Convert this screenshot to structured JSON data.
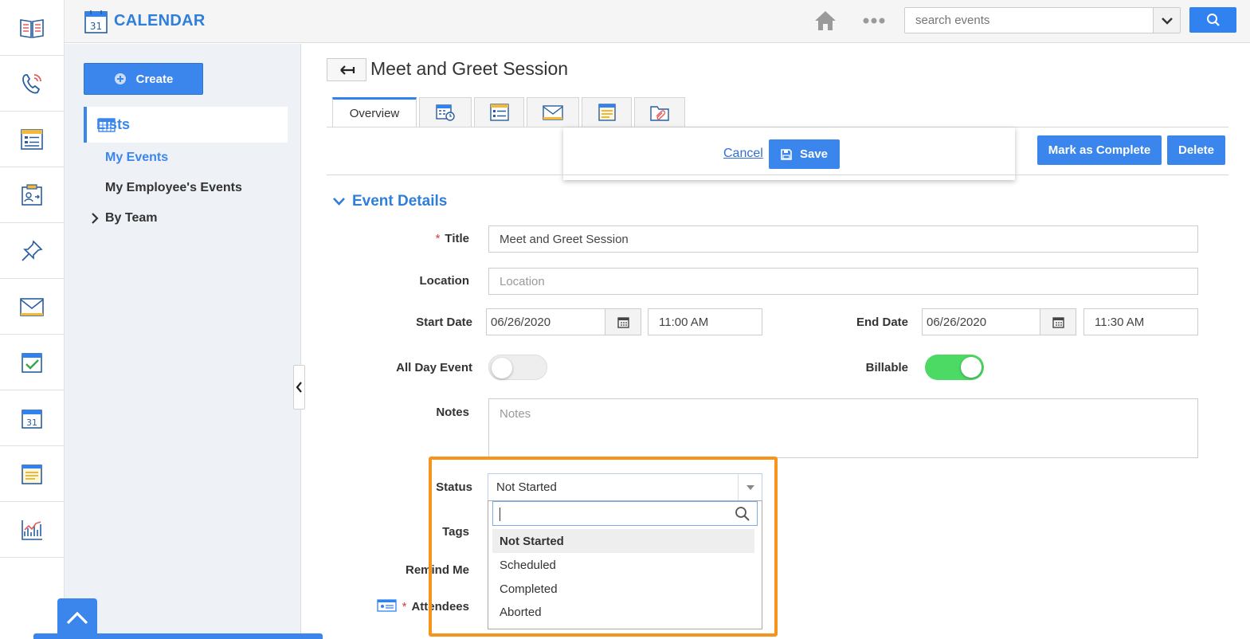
{
  "app": {
    "title": "CALENDAR",
    "icon_day": "31"
  },
  "search": {
    "placeholder": "search events"
  },
  "rail": {
    "items": [
      "book-icon",
      "phone-icon",
      "form-list-icon",
      "contact-card-icon",
      "pin-icon",
      "mail-icon",
      "task-check-icon",
      "calendar-icon",
      "notes-icon",
      "chart-icon"
    ]
  },
  "sidebar": {
    "create_label": "Create",
    "lists_label": "Lists",
    "links": [
      "My Events",
      "My Employee's Events",
      "By Team"
    ]
  },
  "page": {
    "title": "Meet and Greet Session"
  },
  "tabs": {
    "overview": "Overview"
  },
  "toolbar": {
    "cancel": "Cancel",
    "save": "Save",
    "mark_complete": "Mark as Complete",
    "delete": "Delete"
  },
  "form": {
    "section": "Event Details",
    "title_label": "Title",
    "title_value": "Meet and Greet Session",
    "location_label": "Location",
    "location_placeholder": "Location",
    "start_label": "Start Date",
    "start_date": "06/26/2020",
    "start_time": "11:00 AM",
    "end_label": "End Date",
    "end_date": "06/26/2020",
    "end_time": "11:30 AM",
    "allday_label": "All Day Event",
    "allday_on": false,
    "billable_label": "Billable",
    "billable_on": true,
    "notes_label": "Notes",
    "notes_placeholder": "Notes",
    "status_label": "Status",
    "status_value": "Not Started",
    "tags_label": "Tags",
    "remind_label": "Remind Me",
    "attendees_label": "Attendees"
  },
  "status_options": [
    "Not Started",
    "Scheduled",
    "Completed",
    "Aborted"
  ],
  "colors": {
    "accent": "#3b86ec",
    "highlight": "#f7941d",
    "toggle_on": "#4cd964",
    "required": "#e0393e"
  }
}
